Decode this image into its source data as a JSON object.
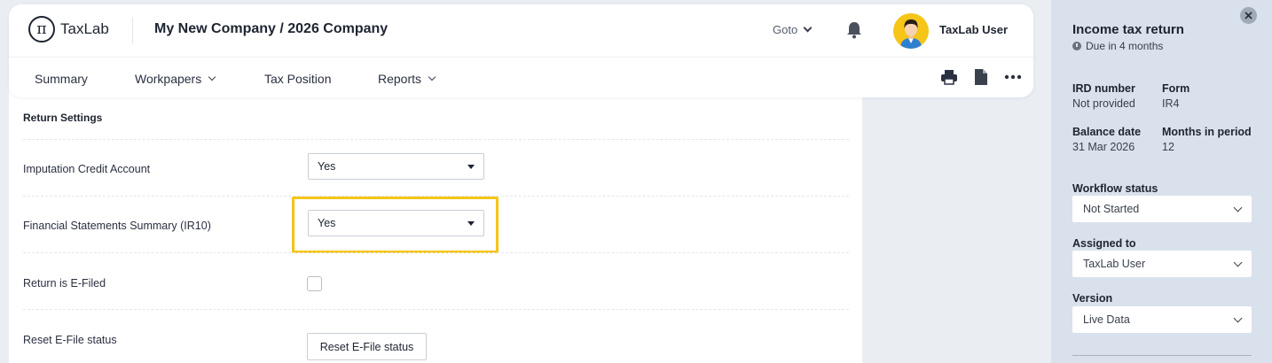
{
  "header": {
    "logo_text": "TaxLab",
    "logo_symbol": "π",
    "company": "My New Company / 2026 Company",
    "goto_label": "Goto",
    "user_name": "TaxLab User",
    "tabs": [
      {
        "label": "Summary",
        "has_dropdown": false
      },
      {
        "label": "Workpapers",
        "has_dropdown": true
      },
      {
        "label": "Tax Position",
        "has_dropdown": false
      },
      {
        "label": "Reports",
        "has_dropdown": true
      }
    ],
    "toolbar_icons": [
      "print-icon",
      "document-icon",
      "more-icon"
    ]
  },
  "main": {
    "section_title": "Return Settings",
    "imputation_label": "Imputation Credit Account",
    "imputation_value": "Yes",
    "ir10_label": "Financial Statements Summary (IR10)",
    "ir10_value": "Yes",
    "efiled_label": "Return is E-Filed",
    "efiled_checked": false,
    "reset_label": "Reset E-File status",
    "reset_button": "Reset E-File status"
  },
  "panel": {
    "title": "Income tax return",
    "due": "Due in 4 months",
    "ird_label": "IRD number",
    "ird_value": "Not provided",
    "form_label": "Form",
    "form_value": "IR4",
    "balance_label": "Balance date",
    "balance_value": "31 Mar 2026",
    "months_label": "Months in period",
    "months_value": "12",
    "workflow_label": "Workflow status",
    "workflow_value": "Not Started",
    "assigned_label": "Assigned to",
    "assigned_value": "TaxLab User",
    "version_label": "Version",
    "version_value": "Live Data"
  },
  "colors": {
    "highlight": "#f5c518",
    "panel_bg": "#d9e1ec",
    "page_bg": "#eaeef3",
    "text_dark": "#1e2430"
  }
}
